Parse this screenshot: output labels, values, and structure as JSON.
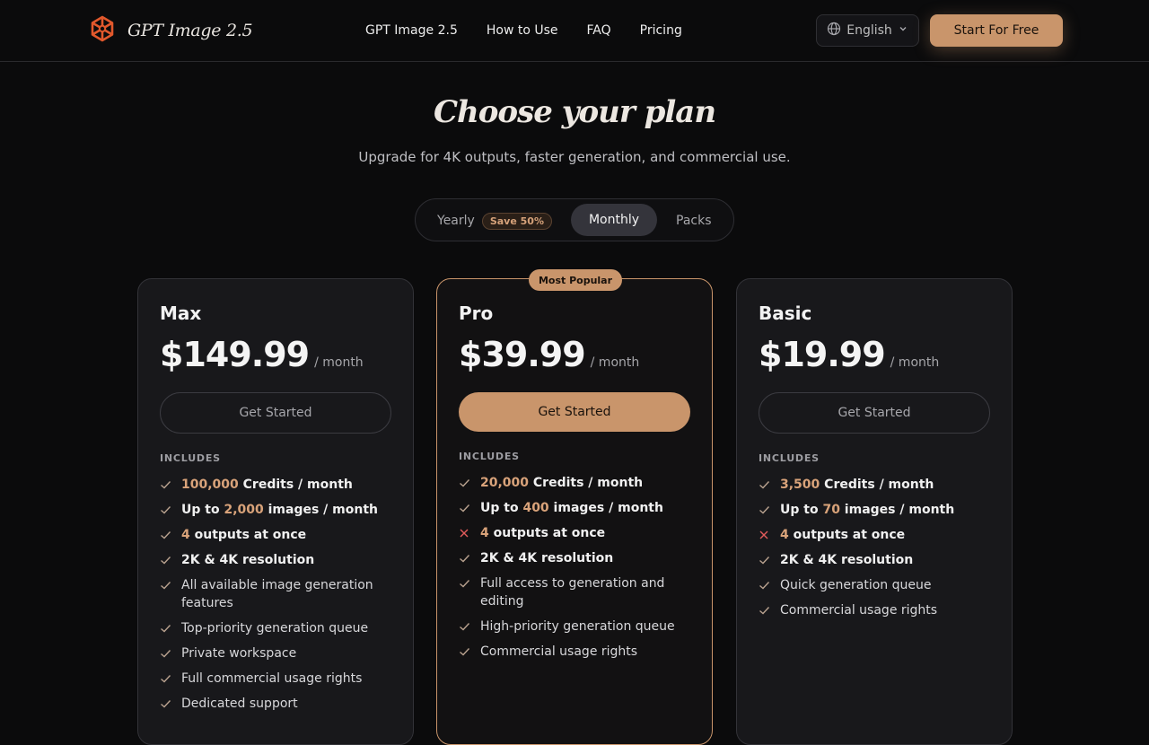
{
  "header": {
    "brand_name": "GPT Image 2.5",
    "nav": [
      "GPT Image 2.5",
      "How to Use",
      "FAQ",
      "Pricing"
    ],
    "language": "English",
    "cta": "Start For Free"
  },
  "hero": {
    "title": "Choose your plan",
    "subtitle": "Upgrade for 4K outputs, faster generation, and commercial use."
  },
  "billing": {
    "yearly": "Yearly",
    "save_badge": "Save 50%",
    "monthly": "Monthly",
    "packs": "Packs",
    "selected": "Monthly"
  },
  "plans": [
    {
      "name": "Max",
      "price": "$149.99",
      "period": "/ month",
      "button": "Get Started",
      "includes": "INCLUDES",
      "features": [
        {
          "icon": "check",
          "bold": true,
          "pre": "",
          "hl": "100,000",
          "post": " Credits / month"
        },
        {
          "icon": "check",
          "bold": true,
          "pre": "Up to ",
          "hl": "2,000",
          "post": " images / month"
        },
        {
          "icon": "check",
          "bold": true,
          "pre": "",
          "hl": "4",
          "post": " outputs at once"
        },
        {
          "icon": "check",
          "bold": true,
          "pre": "2K & 4K resolution",
          "hl": "",
          "post": ""
        },
        {
          "icon": "check",
          "bold": false,
          "pre": "All available image generation features",
          "hl": "",
          "post": ""
        },
        {
          "icon": "check",
          "bold": false,
          "pre": "Top-priority generation queue",
          "hl": "",
          "post": ""
        },
        {
          "icon": "check",
          "bold": false,
          "pre": "Private workspace",
          "hl": "",
          "post": ""
        },
        {
          "icon": "check",
          "bold": false,
          "pre": "Full commercial usage rights",
          "hl": "",
          "post": ""
        },
        {
          "icon": "check",
          "bold": false,
          "pre": "Dedicated support",
          "hl": "",
          "post": ""
        }
      ]
    },
    {
      "name": "Pro",
      "badge": "Most Popular",
      "price": "$39.99",
      "period": "/ month",
      "button": "Get Started",
      "includes": "INCLUDES",
      "features": [
        {
          "icon": "check",
          "bold": true,
          "pre": "",
          "hl": "20,000",
          "post": " Credits / month"
        },
        {
          "icon": "check",
          "bold": true,
          "pre": "Up to ",
          "hl": "400",
          "post": " images / month"
        },
        {
          "icon": "cross",
          "bold": true,
          "pre": "",
          "hl": "4",
          "post": " outputs at once"
        },
        {
          "icon": "check",
          "bold": true,
          "pre": "2K & 4K resolution",
          "hl": "",
          "post": ""
        },
        {
          "icon": "check",
          "bold": false,
          "pre": "Full access to generation and editing",
          "hl": "",
          "post": ""
        },
        {
          "icon": "check",
          "bold": false,
          "pre": "High-priority generation queue",
          "hl": "",
          "post": ""
        },
        {
          "icon": "check",
          "bold": false,
          "pre": "Commercial usage rights",
          "hl": "",
          "post": ""
        }
      ]
    },
    {
      "name": "Basic",
      "price": "$19.99",
      "period": "/ month",
      "button": "Get Started",
      "includes": "INCLUDES",
      "features": [
        {
          "icon": "check",
          "bold": true,
          "pre": "",
          "hl": "3,500",
          "post": " Credits / month"
        },
        {
          "icon": "check",
          "bold": true,
          "pre": "Up to ",
          "hl": "70",
          "post": " images / month"
        },
        {
          "icon": "cross",
          "bold": true,
          "pre": "",
          "hl": "4",
          "post": " outputs at once"
        },
        {
          "icon": "check",
          "bold": true,
          "pre": "2K & 4K resolution",
          "hl": "",
          "post": ""
        },
        {
          "icon": "check",
          "bold": false,
          "pre": "Quick generation queue",
          "hl": "",
          "post": ""
        },
        {
          "icon": "check",
          "bold": false,
          "pre": "Commercial usage rights",
          "hl": "",
          "post": ""
        }
      ]
    }
  ],
  "colors": {
    "accent": "#c9956b",
    "highlight": "#d9a37a",
    "check": "#b9a28f",
    "cross": "#e25b5b",
    "background": "#0b0b0c",
    "card": "#18181b"
  }
}
